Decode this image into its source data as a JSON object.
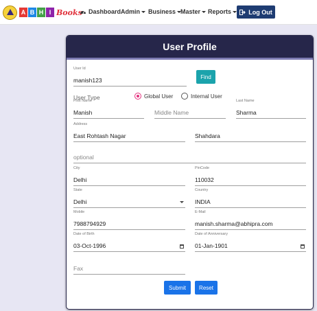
{
  "nav": {
    "logo_letters": [
      "A",
      "B",
      "H",
      "I"
    ],
    "logo_letter_colors": [
      "#e53935",
      "#1e88e5",
      "#43a047",
      "#8e24aa"
    ],
    "logo_books": "Books",
    "dashboard": "Dashboard",
    "admin": "Admin",
    "business": "Business",
    "master": "Master",
    "reports": "Reports",
    "logout": "Log Out"
  },
  "profile": {
    "title": "User Profile",
    "user_id": {
      "label": "User Id",
      "value": "manish123"
    },
    "find": "Find",
    "user_type": {
      "label": "User Type",
      "options": [
        "Global User",
        "Internal User"
      ],
      "selected": "Global User"
    },
    "first_name": {
      "label": "First Name",
      "value": "Manish"
    },
    "middle_name": {
      "placeholder": "Middle Name"
    },
    "last_name": {
      "label": "Last Name",
      "value": "Sharma"
    },
    "address": {
      "label": "Address",
      "line1": "East Rohtash Nagar",
      "line2": "Shahdara",
      "line3_placeholder": "optional"
    },
    "city": {
      "label": "City",
      "value": "Delhi"
    },
    "pincode": {
      "label": "PinCode",
      "value": "110032"
    },
    "state": {
      "label": "State",
      "value": "Delhi"
    },
    "country": {
      "label": "Country",
      "value": "INDIA"
    },
    "mobile": {
      "label": "Mobile",
      "value": "7988794929"
    },
    "email": {
      "label": "E-Mail",
      "value": "manish.sharma@abhipra.com"
    },
    "dob": {
      "label": "Date of Birth",
      "value": "03-Oct-1996"
    },
    "doa": {
      "label": "Date of Anniversary",
      "value": "01-Jan-1901"
    },
    "fax": {
      "placeholder": "Fax"
    },
    "submit": "Submit",
    "reset": "Reset"
  },
  "colors": {
    "header": "#26264a",
    "accent_find": "#1ba3ac",
    "primary": "#1a73e8",
    "radio": "#e3307d",
    "logout": "#1e3c72"
  }
}
